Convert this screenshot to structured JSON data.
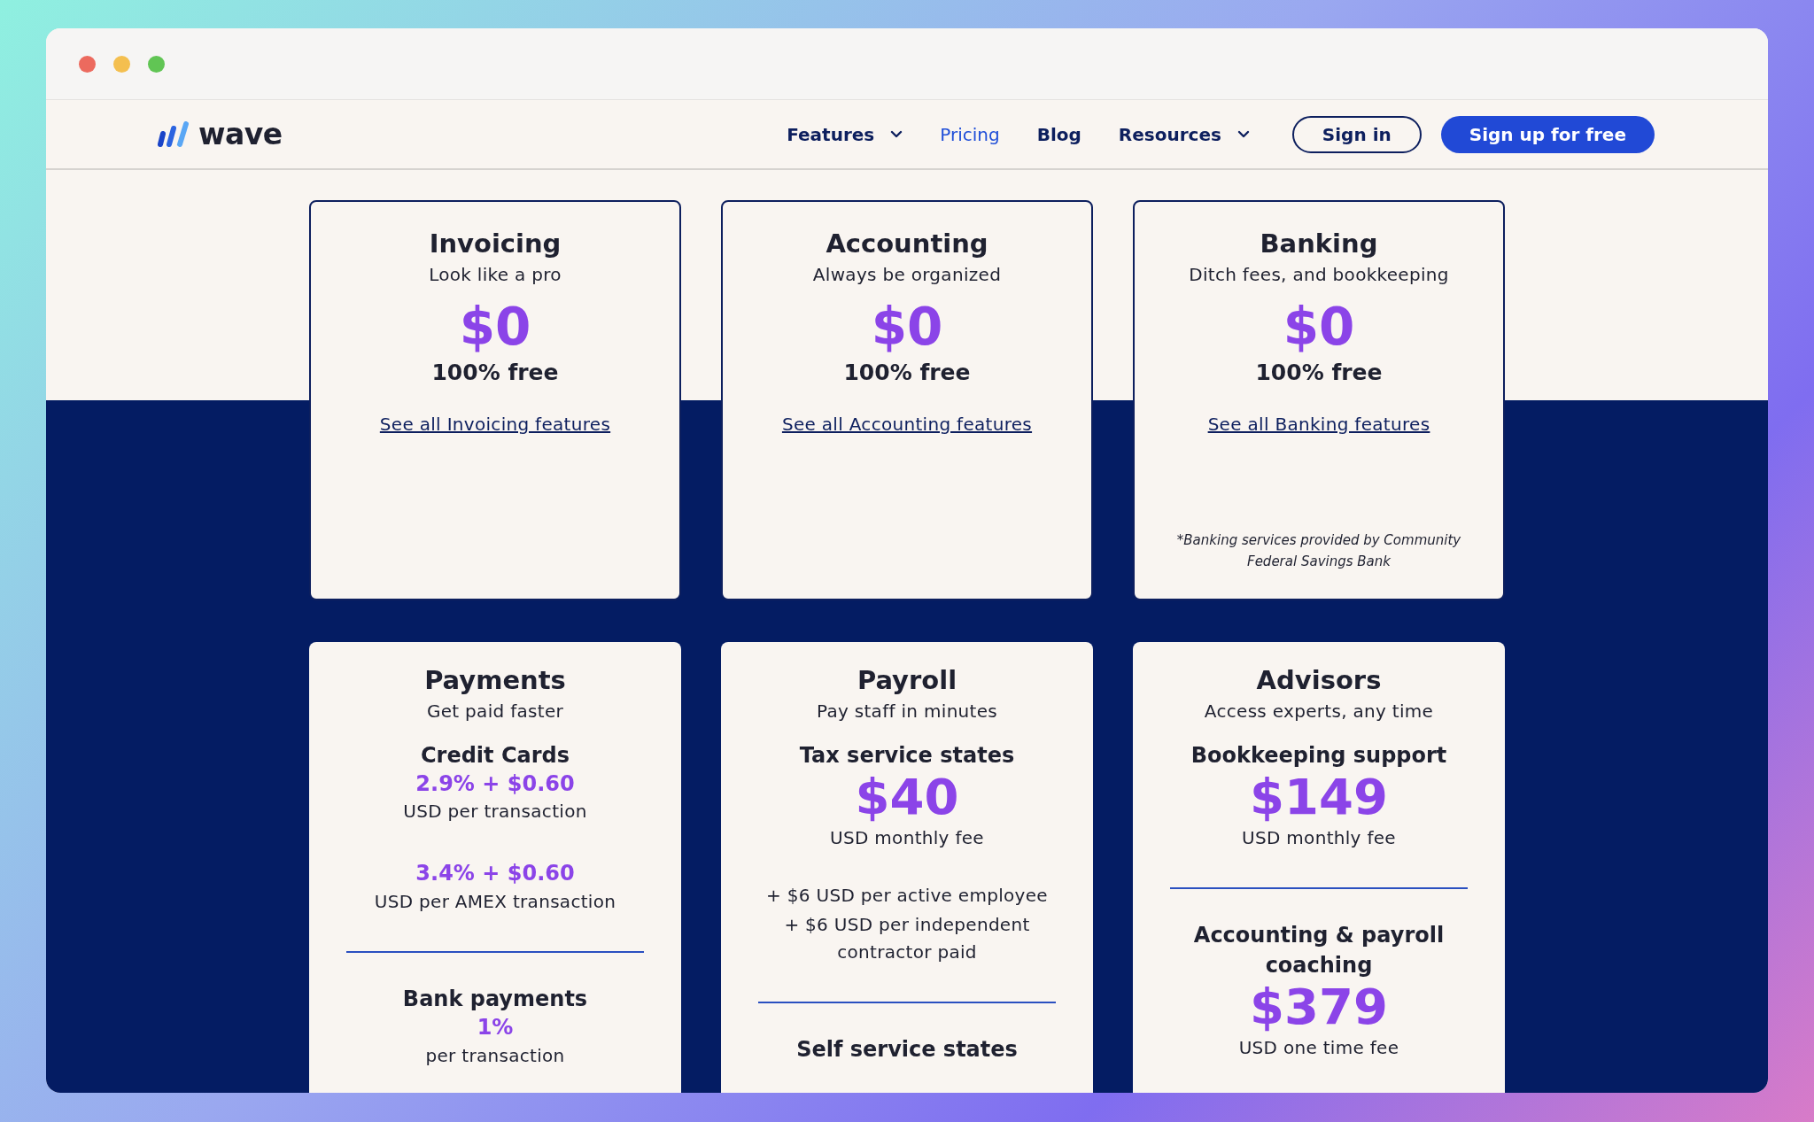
{
  "nav": {
    "logo": "wave",
    "items": [
      {
        "label": "Features",
        "selected": false,
        "dropdown": true
      },
      {
        "label": "Pricing",
        "selected": true,
        "dropdown": false
      },
      {
        "label": "Blog",
        "selected": false,
        "dropdown": false
      },
      {
        "label": "Resources",
        "selected": false,
        "dropdown": true
      }
    ],
    "sign_in": "Sign in",
    "sign_up": "Sign up for free"
  },
  "plans": [
    {
      "title": "Invoicing",
      "subtitle": "Look like a pro",
      "price": "$0",
      "price_note": "100% free",
      "link": "See all Invoicing features"
    },
    {
      "title": "Accounting",
      "subtitle": "Always be organized",
      "price": "$0",
      "price_note": "100% free",
      "link": "See all Accounting features"
    },
    {
      "title": "Banking",
      "subtitle": "Ditch fees, and bookkeeping",
      "price": "$0",
      "price_note": "100% free",
      "link": "See all Banking features",
      "footnote": "*Banking services provided by Community Federal Savings Bank"
    }
  ],
  "services": [
    {
      "title": "Payments",
      "subtitle": "Get paid faster",
      "items": [
        {
          "kind": "label",
          "text": "Credit Cards"
        },
        {
          "kind": "rate",
          "text": "2.9% + $0.60"
        },
        {
          "kind": "note",
          "text": "USD per transaction"
        },
        {
          "kind": "rate",
          "text": "3.4% + $0.60"
        },
        {
          "kind": "note",
          "text": "USD per AMEX transaction"
        },
        {
          "kind": "divider"
        },
        {
          "kind": "label",
          "text": "Bank payments"
        },
        {
          "kind": "rate",
          "text": "1%"
        },
        {
          "kind": "note",
          "text": "per transaction"
        }
      ]
    },
    {
      "title": "Payroll",
      "subtitle": "Pay staff in minutes",
      "items": [
        {
          "kind": "label",
          "text": "Tax service states"
        },
        {
          "kind": "amount",
          "text": "$40"
        },
        {
          "kind": "note",
          "text": "USD monthly fee"
        },
        {
          "kind": "note",
          "text": "+ $6 USD per active employee"
        },
        {
          "kind": "note",
          "text": "+ $6 USD per independent contractor paid"
        },
        {
          "kind": "divider"
        },
        {
          "kind": "label",
          "text": "Self service states"
        }
      ]
    },
    {
      "title": "Advisors",
      "subtitle": "Access experts, any time",
      "items": [
        {
          "kind": "label",
          "text": "Bookkeeping support"
        },
        {
          "kind": "amount",
          "text": "$149"
        },
        {
          "kind": "note",
          "text": "USD monthly fee"
        },
        {
          "kind": "divider"
        },
        {
          "kind": "label",
          "text": "Accounting & payroll coaching"
        },
        {
          "kind": "amount",
          "text": "$379"
        },
        {
          "kind": "note",
          "text": "USD one time fee"
        }
      ]
    }
  ]
}
